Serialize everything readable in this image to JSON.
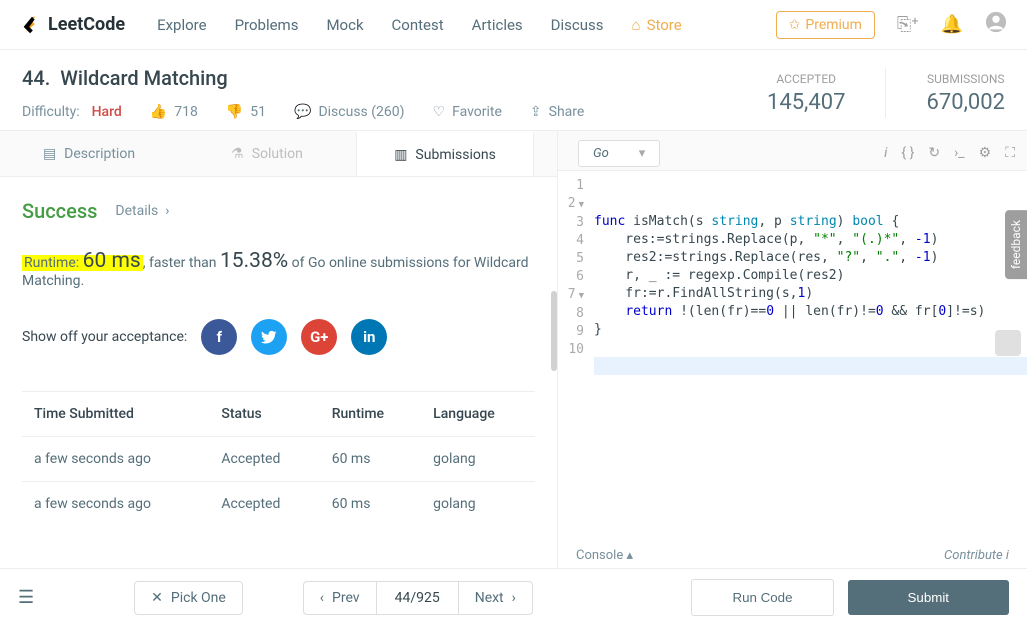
{
  "brand": "LeetCode",
  "nav": {
    "explore": "Explore",
    "problems": "Problems",
    "mock": "Mock",
    "contest": "Contest",
    "articles": "Articles",
    "discuss": "Discuss",
    "store": "Store"
  },
  "premium": "Premium",
  "problem": {
    "number": "44.",
    "title": "Wildcard Matching",
    "difficulty_label": "Difficulty:",
    "difficulty": "Hard",
    "likes": "718",
    "dislikes": "51",
    "discuss": "Discuss (260)",
    "favorite": "Favorite",
    "share": "Share"
  },
  "stats": {
    "accepted_label": "ACCEPTED",
    "accepted": "145,407",
    "submissions_label": "SUBMISSIONS",
    "submissions": "670,002"
  },
  "tabs": {
    "description": "Description",
    "solution": "Solution",
    "submissions": "Submissions"
  },
  "language": "Go",
  "result": {
    "success": "Success",
    "details": "Details",
    "runtime_label": "Runtime:",
    "runtime_value": "60 ms",
    "faster_pre": ", faster than",
    "faster_pct": "15.38%",
    "faster_post": "of Go online submissions for Wildcard Matching.",
    "show_off": "Show off your acceptance:"
  },
  "social": {
    "fb": "f",
    "tw": "🐦",
    "gp": "G+",
    "li": "in"
  },
  "table": {
    "h_time": "Time Submitted",
    "h_status": "Status",
    "h_runtime": "Runtime",
    "h_lang": "Language",
    "rows": [
      {
        "time": "a few seconds ago",
        "status": "Accepted",
        "runtime": "60 ms",
        "lang": "golang"
      },
      {
        "time": "a few seconds ago",
        "status": "Accepted",
        "runtime": "60 ms",
        "lang": "golang"
      }
    ]
  },
  "code_lines": [
    "1",
    "2",
    "3",
    "4",
    "5",
    "6",
    "7",
    "8",
    "9",
    "10"
  ],
  "code": {
    "l2a": "func",
    "l2b": "isMatch(s ",
    "l2c": "string",
    "l2d": ", p ",
    "l2e": "string",
    "l2f": ") ",
    "l2g": "bool",
    "l2h": " {",
    "l3a": "    res:=strings.Replace(p, ",
    "l3b": "\"*\"",
    "l3c": ", ",
    "l3d": "\"(.)*\"",
    "l3e": ", ",
    "l3f": "-1",
    "l3g": ")",
    "l4a": "    res2:=strings.Replace(res, ",
    "l4b": "\"?\"",
    "l4c": ", ",
    "l4d": "\".\"",
    "l4e": ", ",
    "l4f": "-1",
    "l4g": ")",
    "l5": "    r, _ := regexp.Compile(res2)",
    "l6a": "    fr:=r.FindAllString(s,",
    "l6b": "1",
    "l6c": ")",
    "l7a": "    ",
    "l7b": "return",
    "l7c": " !(len(fr)==",
    "l7d": "0",
    "l7e": " || len(fr)!=",
    "l7f": "0",
    "l7g": " && fr[",
    "l7h": "0",
    "l7i": "]!=s)",
    "l8": "}"
  },
  "console": {
    "label": "Console",
    "contribute": "Contribute"
  },
  "bottom": {
    "pick_one": "Pick One",
    "prev": "Prev",
    "page": "44/925",
    "next": "Next",
    "run": "Run Code",
    "submit": "Submit"
  },
  "feedback": "feedback"
}
